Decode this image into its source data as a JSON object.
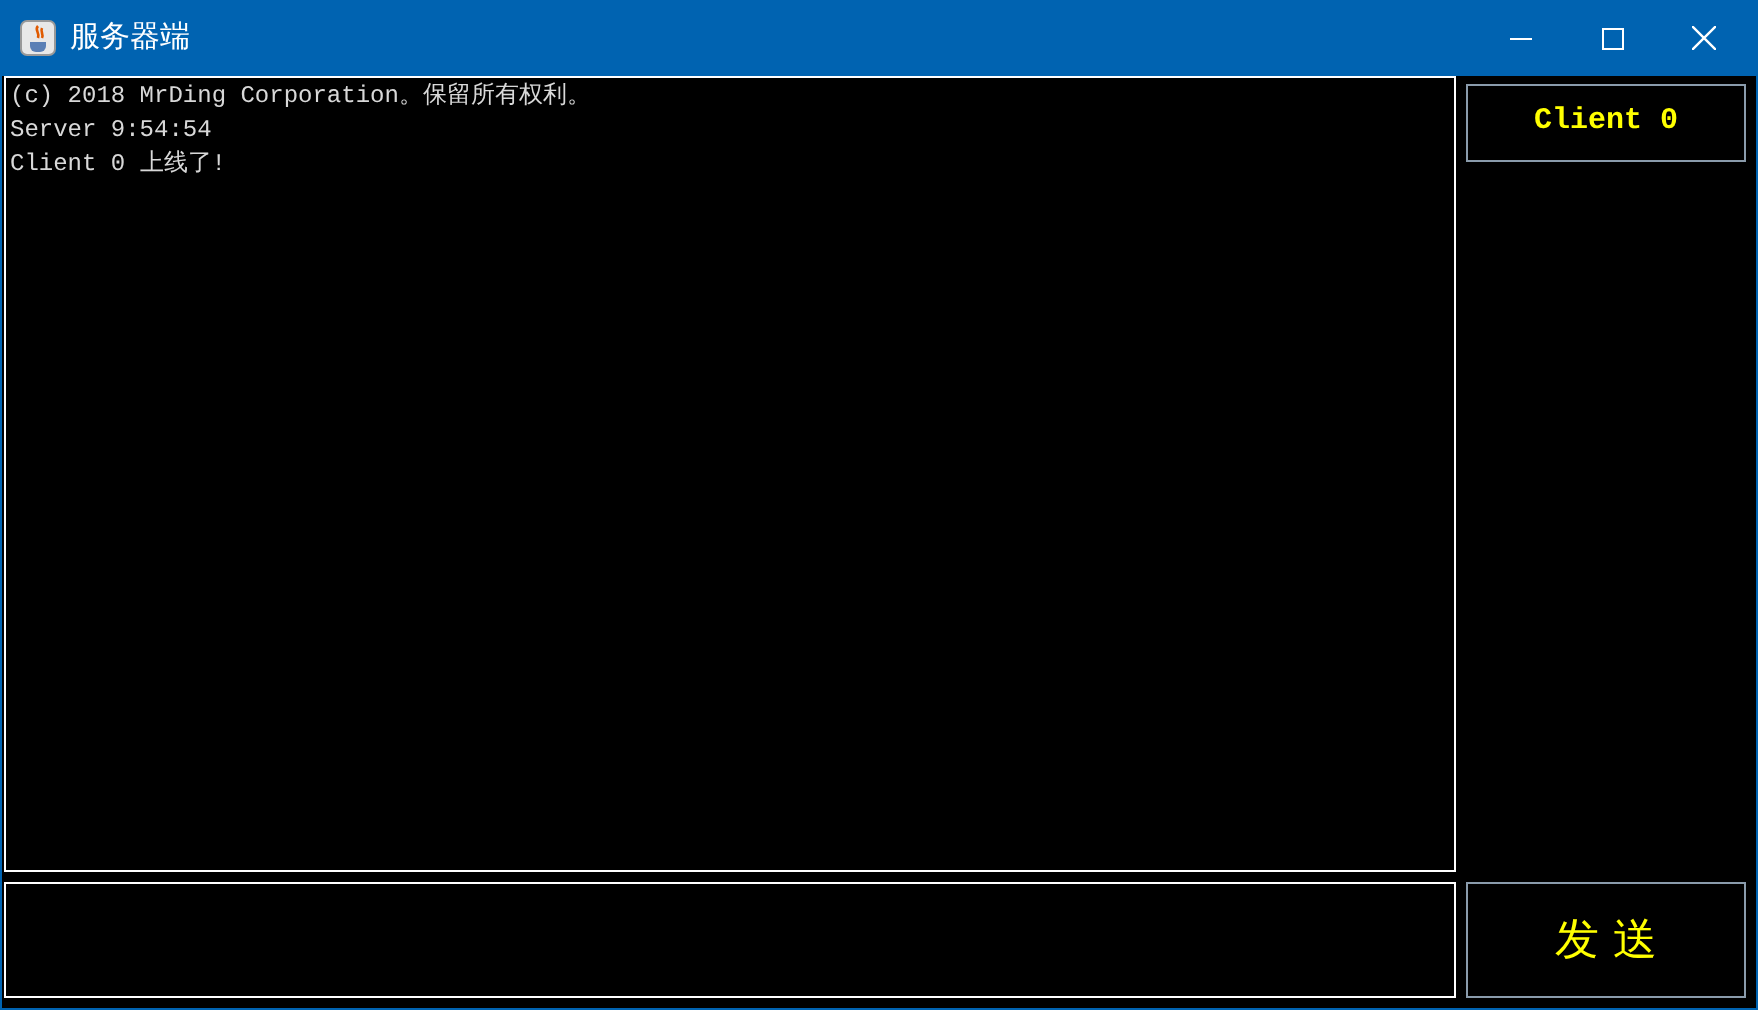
{
  "window": {
    "title": "服务器端"
  },
  "log": [
    "(c) 2018 MrDing Corporation。保留所有权利。",
    "Server 9:54:54",
    "Client 0 上线了!"
  ],
  "clients": [
    {
      "label": "Client 0",
      "selected": false
    }
  ],
  "send_button": {
    "label": "发 送"
  }
}
